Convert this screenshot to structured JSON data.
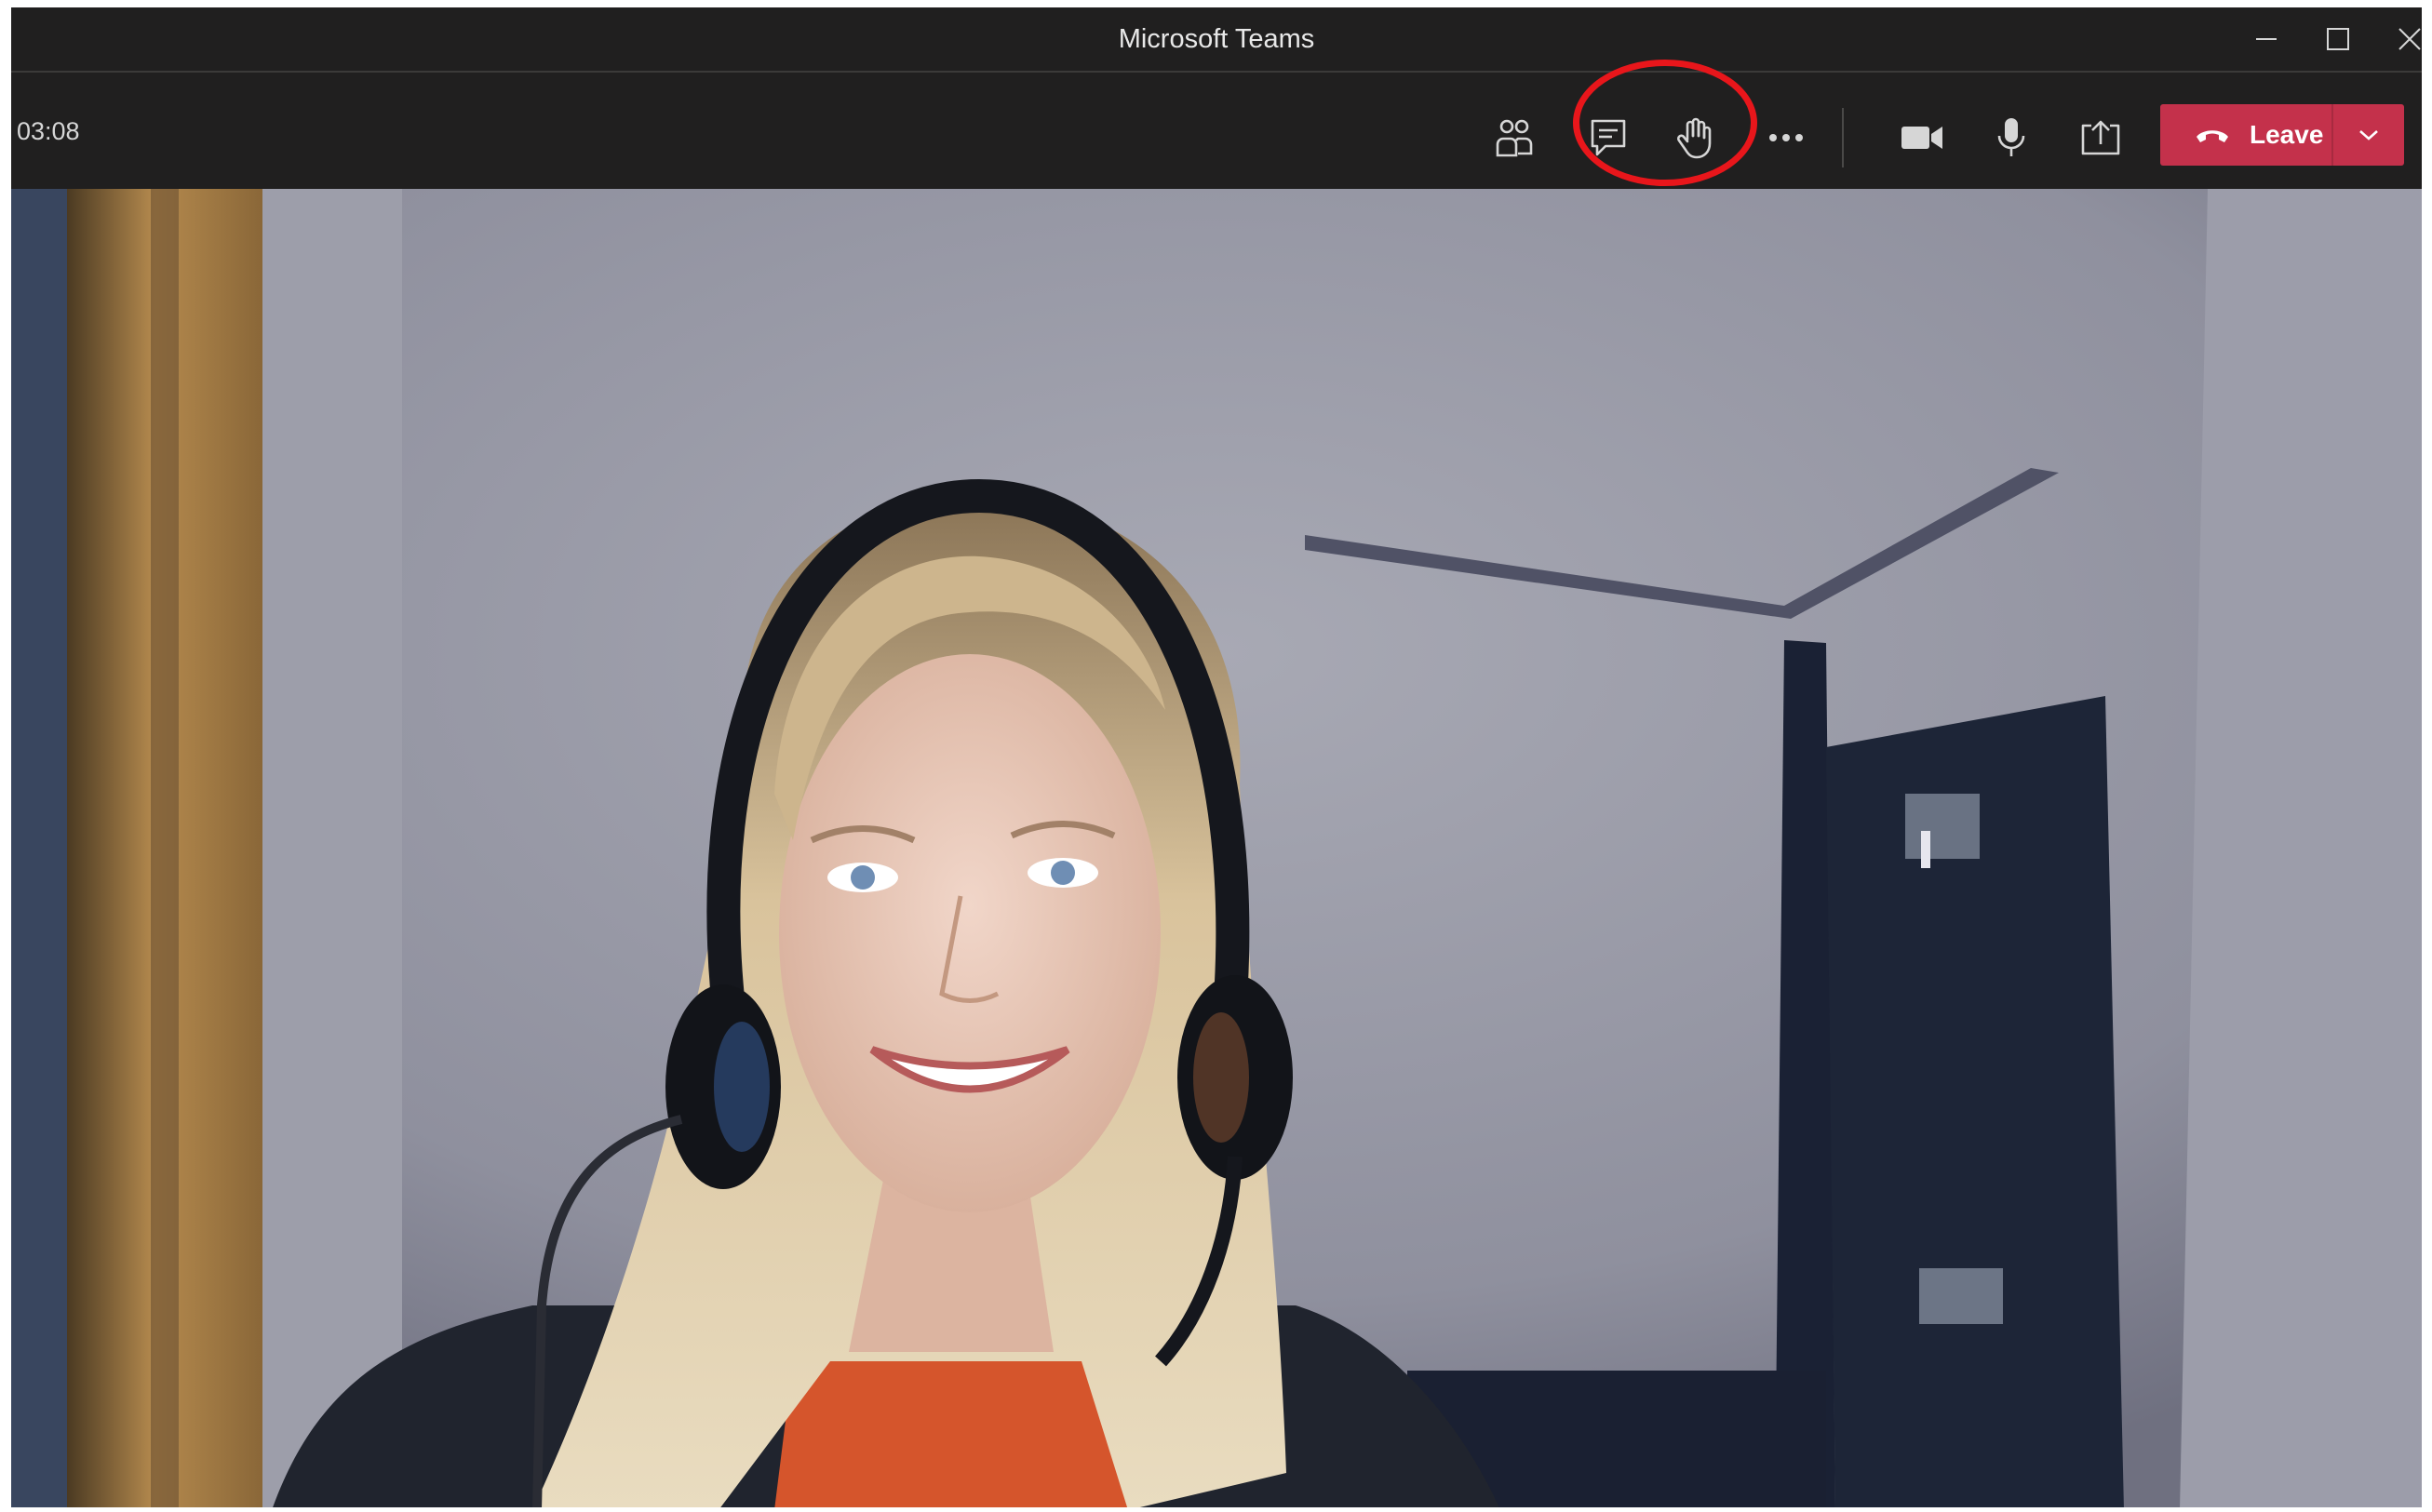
{
  "window": {
    "title": "Microsoft Teams",
    "controls": [
      "minimize-icon",
      "maximize-icon",
      "close-icon"
    ]
  },
  "toolbar": {
    "timer": "03:08",
    "buttons": [
      {
        "name": "show-participants",
        "icon": "people-icon"
      },
      {
        "name": "show-conversation",
        "icon": "chat-icon"
      },
      {
        "name": "raise-hand",
        "icon": "hand-icon",
        "highlighted": true
      },
      {
        "name": "more-actions",
        "icon": "ellipsis-icon"
      },
      {
        "name": "camera-toggle",
        "icon": "video-camera-icon"
      },
      {
        "name": "mic-toggle",
        "icon": "microphone-icon"
      },
      {
        "name": "share-content",
        "icon": "share-tray-icon"
      }
    ],
    "leave_label": "Leave",
    "leave_icon": "phone-hangup-icon",
    "leave_dropdown_icon": "chevron-down-icon"
  },
  "annotation": {
    "color": "#e8161b",
    "target": "raise-hand"
  },
  "video": {
    "subject": "participant-webcam-feed"
  },
  "colors": {
    "chrome_bg": "#201f1f",
    "leave_red": "#c4314b",
    "icon_color": "#d6d6d6"
  }
}
